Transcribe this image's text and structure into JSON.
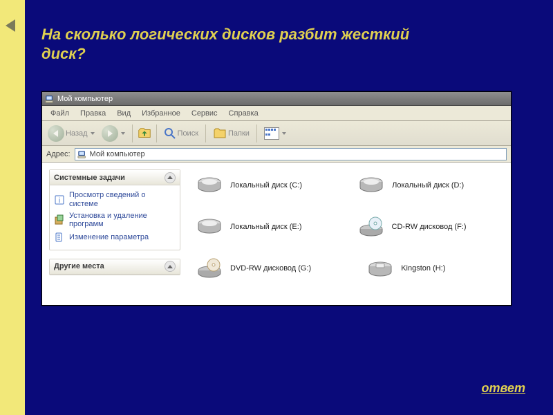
{
  "slide": {
    "question": "На сколько логических дисков разбит жесткий диск?",
    "answer_link": "ответ"
  },
  "window": {
    "title": "Мой компьютер",
    "menus": [
      "Файл",
      "Правка",
      "Вид",
      "Избранное",
      "Сервис",
      "Справка"
    ],
    "back_label": "Назад",
    "search_label": "Поиск",
    "folders_label": "Папки",
    "address_label": "Адрес:",
    "address_value": "Мой компьютер"
  },
  "tasks": {
    "system_title": "Системные задачи",
    "items": [
      "Просмотр сведений о системе",
      "Установка и удаление программ",
      "Изменение параметра"
    ],
    "other_title": "Другие места"
  },
  "drives": [
    {
      "label": "Локальный диск (C:)",
      "type": "hdd"
    },
    {
      "label": "Локальный диск (D:)",
      "type": "hdd"
    },
    {
      "label": "Локальный диск (E:)",
      "type": "hdd"
    },
    {
      "label": "CD-RW дисковод (F:)",
      "type": "cd"
    },
    {
      "label": "DVD-RW дисковод (G:)",
      "type": "dvd"
    },
    {
      "label": "Kingston (H:)",
      "type": "usb"
    }
  ]
}
